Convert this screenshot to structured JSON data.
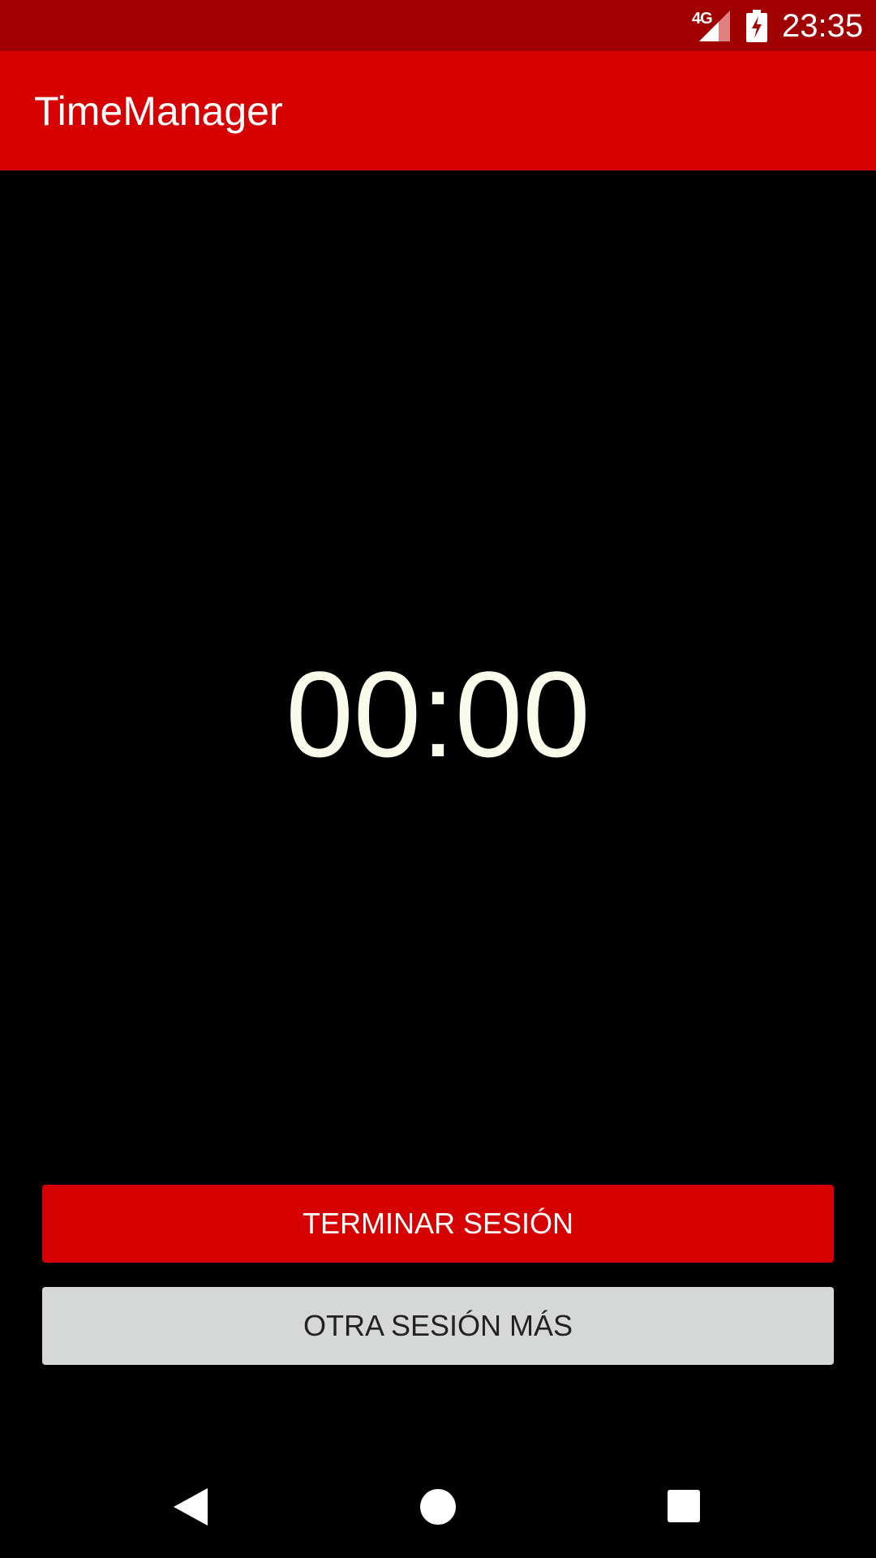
{
  "status_bar": {
    "network_label": "4G",
    "time": "23:35",
    "icons": [
      "signal-icon",
      "battery-charging-icon"
    ]
  },
  "app_bar": {
    "title": "TimeManager"
  },
  "timer": {
    "display": "00:00"
  },
  "buttons": {
    "end_session_label": "TERMINAR SESIÓN",
    "another_session_label": "OTRA SESIÓN MÁS"
  },
  "nav_bar": {
    "icons": [
      "back-icon",
      "home-icon",
      "recents-icon"
    ]
  },
  "colors": {
    "status_bar": "#a00000",
    "primary": "#d50000",
    "background": "#000000",
    "timer_text": "#fbfbec",
    "secondary_button": "#d6d7d7"
  }
}
